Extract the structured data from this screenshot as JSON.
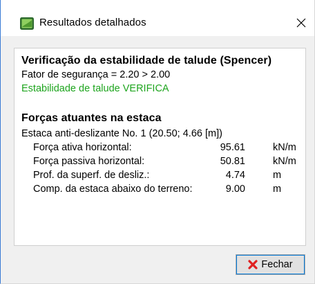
{
  "window": {
    "title": "Resultados detalhados"
  },
  "report": {
    "heading": "Verificação da estabilidade de talude (Spencer)",
    "safety_factor": "Fator de segurança = 2.20 > 2.00",
    "status": "Estabilidade de talude VERIFICA",
    "forces_heading": "Forças atuantes na estaca",
    "pile_title": "Estaca anti-deslizante No. 1 (20.50; 4.66 [m])",
    "rows": [
      {
        "label": "Força ativa horizontal:",
        "value": "95.61",
        "unit": "kN/m"
      },
      {
        "label": "Força passiva horizontal:",
        "value": "50.81",
        "unit": "kN/m"
      },
      {
        "label": "Prof. da superf. de desliz.:",
        "value": "4.74",
        "unit": "m"
      },
      {
        "label": "Comp. da estaca abaixo do terreno:",
        "value": "9.00",
        "unit": "m"
      }
    ]
  },
  "footer": {
    "close_label": "Fechar"
  },
  "colors": {
    "status_ok": "#1ea51e",
    "close_icon": "#e02020",
    "focus": "#0078d7"
  },
  "icons": {
    "app": "app-icon",
    "window_close": "close-icon",
    "button": "red-x-icon"
  }
}
